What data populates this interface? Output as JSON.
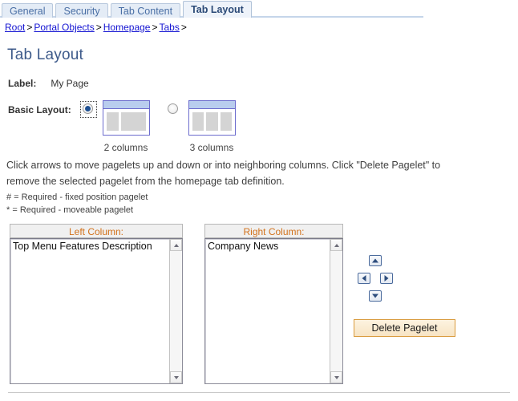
{
  "tabs": [
    {
      "label": "General",
      "active": false
    },
    {
      "label": "Security",
      "active": false
    },
    {
      "label": "Tab Content",
      "active": false
    },
    {
      "label": "Tab Layout",
      "active": true
    }
  ],
  "breadcrumb": {
    "items": [
      "Root",
      "Portal Objects",
      "Homepage",
      "Tabs"
    ],
    "separator": ">",
    "trailing_separator": ">"
  },
  "page": {
    "title": "Tab Layout"
  },
  "label_field": {
    "label": "Label:",
    "value": "My Page"
  },
  "basic_layout": {
    "label": "Basic Layout:",
    "options": [
      {
        "caption": "2 columns",
        "selected": true,
        "columns": 2
      },
      {
        "caption": "3 columns",
        "selected": false,
        "columns": 3
      }
    ]
  },
  "instructions": {
    "paragraph": "Click arrows to move pagelets up and down or into neighboring columns. Click \"Delete Pagelet\" to remove the selected pagelet from the homepage tab definition.",
    "note_fixed": "# = Required - fixed position pagelet",
    "note_moveable": "* = Required - moveable pagelet"
  },
  "columns": [
    {
      "header": "Left Column:",
      "items": [
        "Top Menu Features Description"
      ]
    },
    {
      "header": "Right Column:",
      "items": [
        "Company News"
      ]
    }
  ],
  "arrow_controls": [
    {
      "name": "move-up",
      "glyph": "up"
    },
    {
      "name": "move-left",
      "glyph": "left"
    },
    {
      "name": "move-right",
      "glyph": "right"
    },
    {
      "name": "move-down",
      "glyph": "down"
    }
  ],
  "delete_button": {
    "label": "Delete Pagelet"
  },
  "colors": {
    "page_title": "#3d5a8a",
    "link": "#1414d2",
    "column_header_text": "#d2721c",
    "active_tab_text": "#2b4a77",
    "inactive_tab_text": "#4a6fa5",
    "thumb_border": "#6c6ccd",
    "thumb_header": "#b9cdee",
    "thumb_column": "#d4d4d4",
    "delete_border": "#d99b3d",
    "arrow_border": "#4a6a9c"
  }
}
